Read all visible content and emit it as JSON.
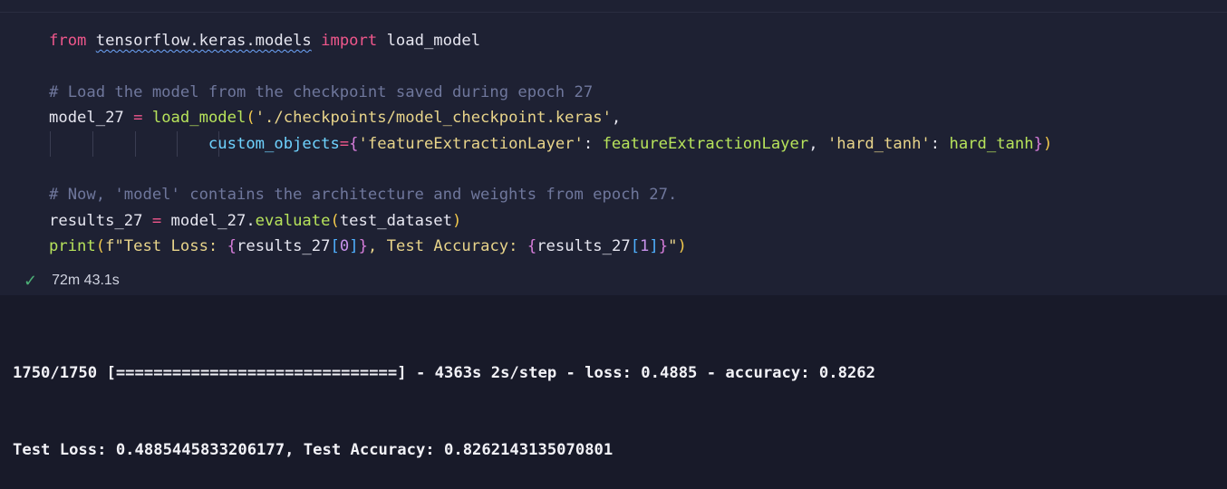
{
  "cell": {
    "lines": [
      {
        "tokens": [
          {
            "t": "from",
            "c": "kw"
          },
          {
            "t": " ",
            "c": ""
          },
          {
            "t": "tensorflow.keras.models",
            "c": "squig"
          },
          {
            "t": " ",
            "c": ""
          },
          {
            "t": "import",
            "c": "kw"
          },
          {
            "t": " load_model",
            "c": ""
          }
        ]
      },
      {
        "tokens": []
      },
      {
        "tokens": [
          {
            "t": "# Load the model from the checkpoint saved during epoch 27",
            "c": "cm"
          }
        ]
      },
      {
        "tokens": [
          {
            "t": "model_27 ",
            "c": ""
          },
          {
            "t": "=",
            "c": "op"
          },
          {
            "t": " ",
            "c": ""
          },
          {
            "t": "load_model",
            "c": "fn"
          },
          {
            "t": "(",
            "c": "b1"
          },
          {
            "t": "'./checkpoints/model_checkpoint.keras'",
            "c": "st"
          },
          {
            "t": ",",
            "c": ""
          }
        ]
      },
      {
        "tokens": [
          {
            "t": "                 ",
            "c": ""
          },
          {
            "t": "custom_objects",
            "c": "param"
          },
          {
            "t": "=",
            "c": "op"
          },
          {
            "t": "{",
            "c": "b2"
          },
          {
            "t": "'featureExtractionLayer'",
            "c": "st"
          },
          {
            "t": ": ",
            "c": ""
          },
          {
            "t": "featureExtractionLayer",
            "c": "fn"
          },
          {
            "t": ", ",
            "c": ""
          },
          {
            "t": "'hard_tanh'",
            "c": "st"
          },
          {
            "t": ": ",
            "c": ""
          },
          {
            "t": "hard_tanh",
            "c": "fn"
          },
          {
            "t": "}",
            "c": "b2"
          },
          {
            "t": ")",
            "c": "b1"
          }
        ]
      },
      {
        "tokens": []
      },
      {
        "tokens": [
          {
            "t": "# Now, 'model' contains the architecture and weights from epoch 27.",
            "c": "cm"
          }
        ]
      },
      {
        "tokens": [
          {
            "t": "results_27 ",
            "c": ""
          },
          {
            "t": "=",
            "c": "op"
          },
          {
            "t": " model_27.",
            "c": ""
          },
          {
            "t": "evaluate",
            "c": "fn"
          },
          {
            "t": "(",
            "c": "b1"
          },
          {
            "t": "test_dataset",
            "c": ""
          },
          {
            "t": ")",
            "c": "b1"
          }
        ]
      },
      {
        "tokens": [
          {
            "t": "print",
            "c": "fn"
          },
          {
            "t": "(",
            "c": "b1"
          },
          {
            "t": "f\"Test Loss: ",
            "c": "st"
          },
          {
            "t": "{",
            "c": "b2"
          },
          {
            "t": "results_27",
            "c": ""
          },
          {
            "t": "[",
            "c": "b3"
          },
          {
            "t": "0",
            "c": "num"
          },
          {
            "t": "]",
            "c": "b3"
          },
          {
            "t": "}",
            "c": "b2"
          },
          {
            "t": ", Test Accuracy: ",
            "c": "st"
          },
          {
            "t": "{",
            "c": "b2"
          },
          {
            "t": "results_27",
            "c": ""
          },
          {
            "t": "[",
            "c": "b3"
          },
          {
            "t": "1",
            "c": "num"
          },
          {
            "t": "]",
            "c": "b3"
          },
          {
            "t": "}",
            "c": "b2"
          },
          {
            "t": "\"",
            "c": "st"
          },
          {
            "t": ")",
            "c": "b1"
          }
        ]
      }
    ],
    "exec_time": "72m 43.1s",
    "status_icon": "check-icon"
  },
  "output": {
    "lines": [
      "1750/1750 [==============================] - 4363s 2s/step - loss: 0.4885 - accuracy: 0.8262",
      "Test Loss: 0.4885445833206177, Test Accuracy: 0.8262143135070801"
    ]
  },
  "colors": {
    "keyword": "#f0578c",
    "function": "#b7e35b",
    "comment": "#6f779c",
    "string": "#e8d48a",
    "success": "#4caf76"
  }
}
